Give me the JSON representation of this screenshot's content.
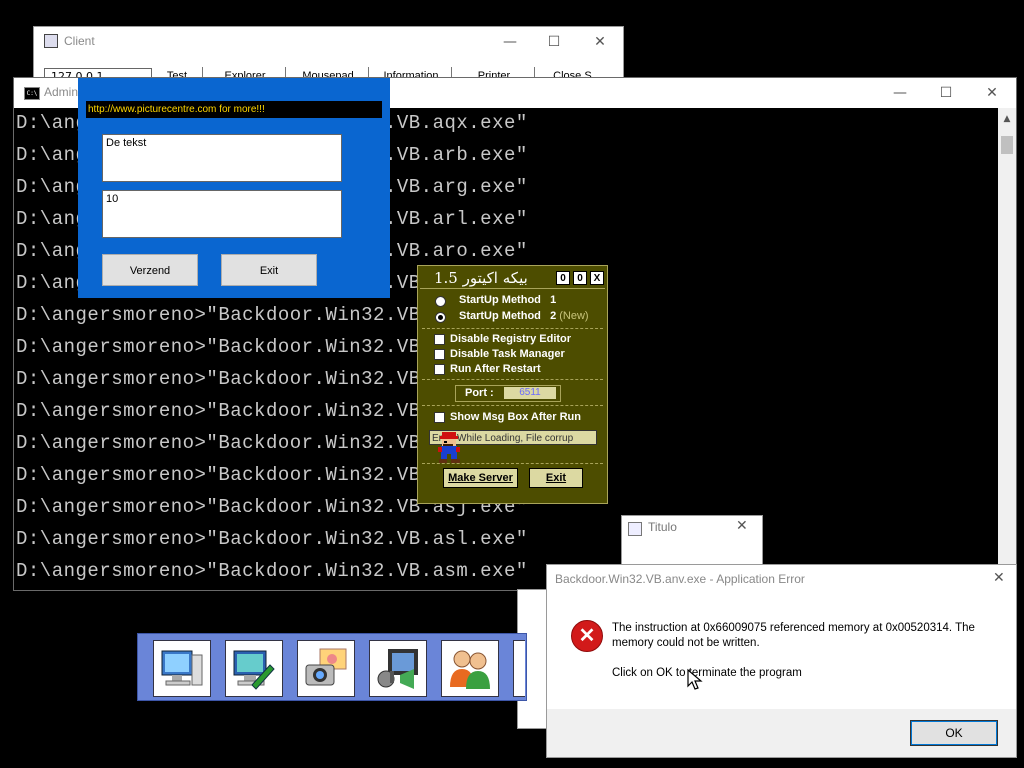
{
  "client": {
    "title": "Client",
    "ip_value": "127.0.0.1",
    "tabs": [
      "Test",
      "Explorer",
      "Mousepad",
      "Information",
      "Printer",
      "Close S..."
    ]
  },
  "console": {
    "title": "Admin",
    "lines": [
      "D:\\angersmoreno>\"Backdoor.Win32.VB.aqx.exe\"",
      "D:\\angersmoreno>\"Backdoor.Win32.VB.arb.exe\"",
      "D:\\angersmoreno>\"Backdoor.Win32.VB.arg.exe\"",
      "D:\\angersmoreno>\"Backdoor.Win32.VB.arl.exe\"",
      "D:\\angersmoreno>\"Backdoor.Win32.VB.aro.exe\"",
      "D:\\angersmoreno>\"Backdoor.Win32.VB.arp.exe\"",
      "D:\\angersmoreno>\"Backdoor.Win32.VB.arr.exe\"",
      "D:\\angersmoreno>\"Backdoor.Win32.VB.ars.exe\"",
      "D:\\angersmoreno>\"Backdoor.Win32.VB.art.exe\"",
      "D:\\angersmoreno>\"Backdoor.Win32.VB.arx.exe\"",
      "D:\\angersmoreno>\"Backdoor.Win32.VB.asa.exe\"",
      "D:\\angersmoreno>\"Backdoor.Win32.VB.asb.exe\"",
      "D:\\angersmoreno>\"Backdoor.Win32.VB.asj.exe\"",
      "D:\\angersmoreno>\"Backdoor.Win32.VB.asl.exe\"",
      "D:\\angersmoreno>\"Backdoor.Win32.VB.asm.exe\""
    ]
  },
  "blue_form": {
    "url_banner": "http://www.picturecentre.com for more!!!",
    "text1": "De tekst",
    "text2": "10",
    "send_label": "Verzend",
    "exit_label": "Exit"
  },
  "builder": {
    "title": "1.5 بيكه اكيتور",
    "ctl_min": "0",
    "ctl_max": "0",
    "ctl_close": "X",
    "startup1_label": "StartUp Method",
    "startup1_num": "1",
    "startup2_label": "StartUp Method",
    "startup2_num": "2",
    "startup2_note": "(New)",
    "startup_selected": 2,
    "opt_registry": "Disable Registry Editor",
    "opt_taskmgr": "Disable Task Manager",
    "opt_restart": "Run After Restart",
    "port_label": "Port :",
    "port_value": "6511",
    "opt_msgbox": "Show Msg Box After Run",
    "msgbox_text": "Error While Loading,  File corrup",
    "make_server": "Make Server",
    "exit": "Exit"
  },
  "titulo": {
    "title": "Titulo"
  },
  "error_dialog": {
    "title": "Backdoor.Win32.VB.anv.exe - Application Error",
    "message_line1": "The instruction at 0x66009075 referenced memory at 0x00520314. The",
    "message_line2": "memory could not be written.",
    "message_line3": "Click on OK to terminate the program",
    "ok_label": "OK"
  },
  "icon_bar": {
    "icons": [
      "computer-icon",
      "display-settings-icon",
      "camera-photo-icon",
      "media-film-icon",
      "users-icon"
    ]
  }
}
